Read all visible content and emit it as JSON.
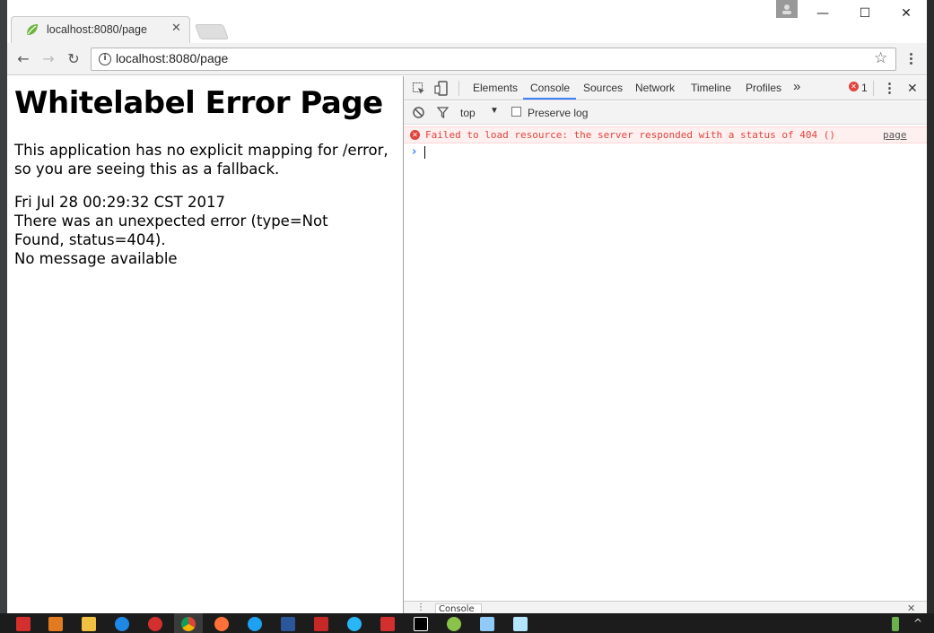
{
  "window": {
    "tab_title": "localhost:8080/page",
    "tab_close": "✕",
    "minimize": "—",
    "maximize": "☐",
    "close": "✕"
  },
  "toolbar": {
    "back": "←",
    "forward": "→",
    "reload": "↻",
    "url": "localhost:8080/page",
    "bookmark_star": "☆",
    "menu": "⋮",
    "info": "i"
  },
  "page": {
    "heading": "Whitelabel Error Page",
    "line1": "This application has no explicit mapping for /error, so you are seeing this as a fallback.",
    "timestamp": "Fri Jul 28 00:29:32 CST 2017",
    "error_detail": "There was an unexpected error (type=Not Found, status=404).",
    "message": "No message available"
  },
  "devtools": {
    "tabs": [
      "Elements",
      "Console",
      "Sources",
      "Network",
      "Timeline",
      "Profiles"
    ],
    "active_tab": "Console",
    "more": "»",
    "error_count": "1",
    "menu": "⋮",
    "close": "✕",
    "context": "top",
    "context_arrow": "▼",
    "preserve_log": "Preserve log",
    "error_message": "Failed to load resource: the server responded with a status of 404 ()",
    "error_source": "page",
    "prompt": "›",
    "drawer_tab": "Console",
    "drawer_close": "✕",
    "drawer_menu": "⋮"
  },
  "colors": {
    "error_red": "#e0443e",
    "accent_blue": "#3e82f7"
  }
}
